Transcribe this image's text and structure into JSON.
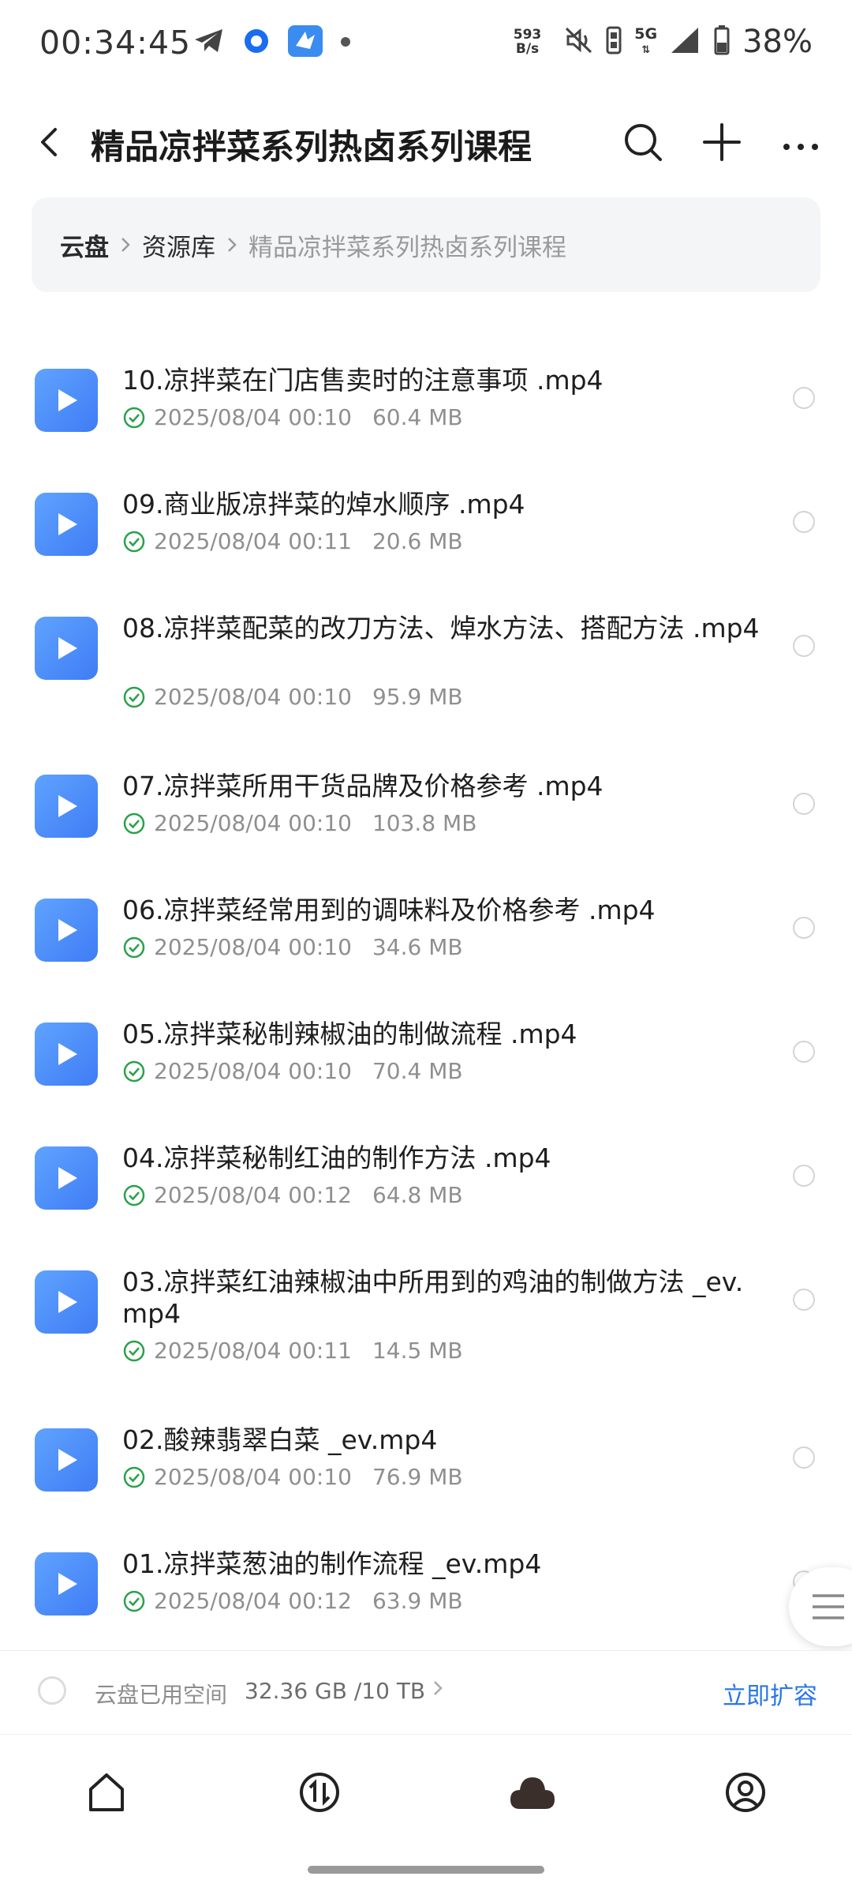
{
  "status_bar": {
    "time": "00:34:45",
    "net_speed_value": "593",
    "net_speed_unit": "B/s",
    "network_type": "5G",
    "battery": "38%"
  },
  "header": {
    "title": "精品凉拌菜系列热卤系列课程"
  },
  "breadcrumb": {
    "items": [
      "云盘",
      "资源库",
      "精品凉拌菜系列热卤系列课程"
    ]
  },
  "files": [
    {
      "name": "10.凉拌菜在门店售卖时的注意事项 .mp4",
      "date": "2025/08/04 00:10",
      "size": "60.4 MB"
    },
    {
      "name": "09.商业版凉拌菜的焯水顺序 .mp4",
      "date": "2025/08/04 00:11",
      "size": "20.6 MB"
    },
    {
      "name": "08.凉拌菜配菜的改刀方法、焯水方法、搭配方法 .mp4",
      "date": "2025/08/04 00:10",
      "size": "95.9 MB"
    },
    {
      "name": "07.凉拌菜所用干货品牌及价格参考 .mp4",
      "date": "2025/08/04 00:10",
      "size": "103.8 MB"
    },
    {
      "name": "06.凉拌菜经常用到的调味料及价格参考 .mp4",
      "date": "2025/08/04 00:10",
      "size": "34.6 MB"
    },
    {
      "name": "05.凉拌菜秘制辣椒油的制做流程 .mp4",
      "date": "2025/08/04 00:10",
      "size": "70.4 MB"
    },
    {
      "name": "04.凉拌菜秘制红油的制作方法 .mp4",
      "date": "2025/08/04 00:12",
      "size": "64.8 MB"
    },
    {
      "name": "03.凉拌菜红油辣椒油中所用到的鸡油的制做方法 _ev.mp4",
      "date": "2025/08/04 00:11",
      "size": "14.5 MB"
    },
    {
      "name": "02.酸辣翡翠白菜 _ev.mp4",
      "date": "2025/08/04 00:10",
      "size": "76.9 MB"
    },
    {
      "name": "01.凉拌菜葱油的制作流程 _ev.mp4",
      "date": "2025/08/04 00:12",
      "size": "63.9 MB"
    }
  ],
  "storage": {
    "label": "云盘已用空间",
    "value": "32.36 GB /10 TB",
    "action": "立即扩容"
  },
  "colors": {
    "accent": "#2a77e6",
    "file_icon": "#4a8af8",
    "check": "#2aa14b"
  }
}
